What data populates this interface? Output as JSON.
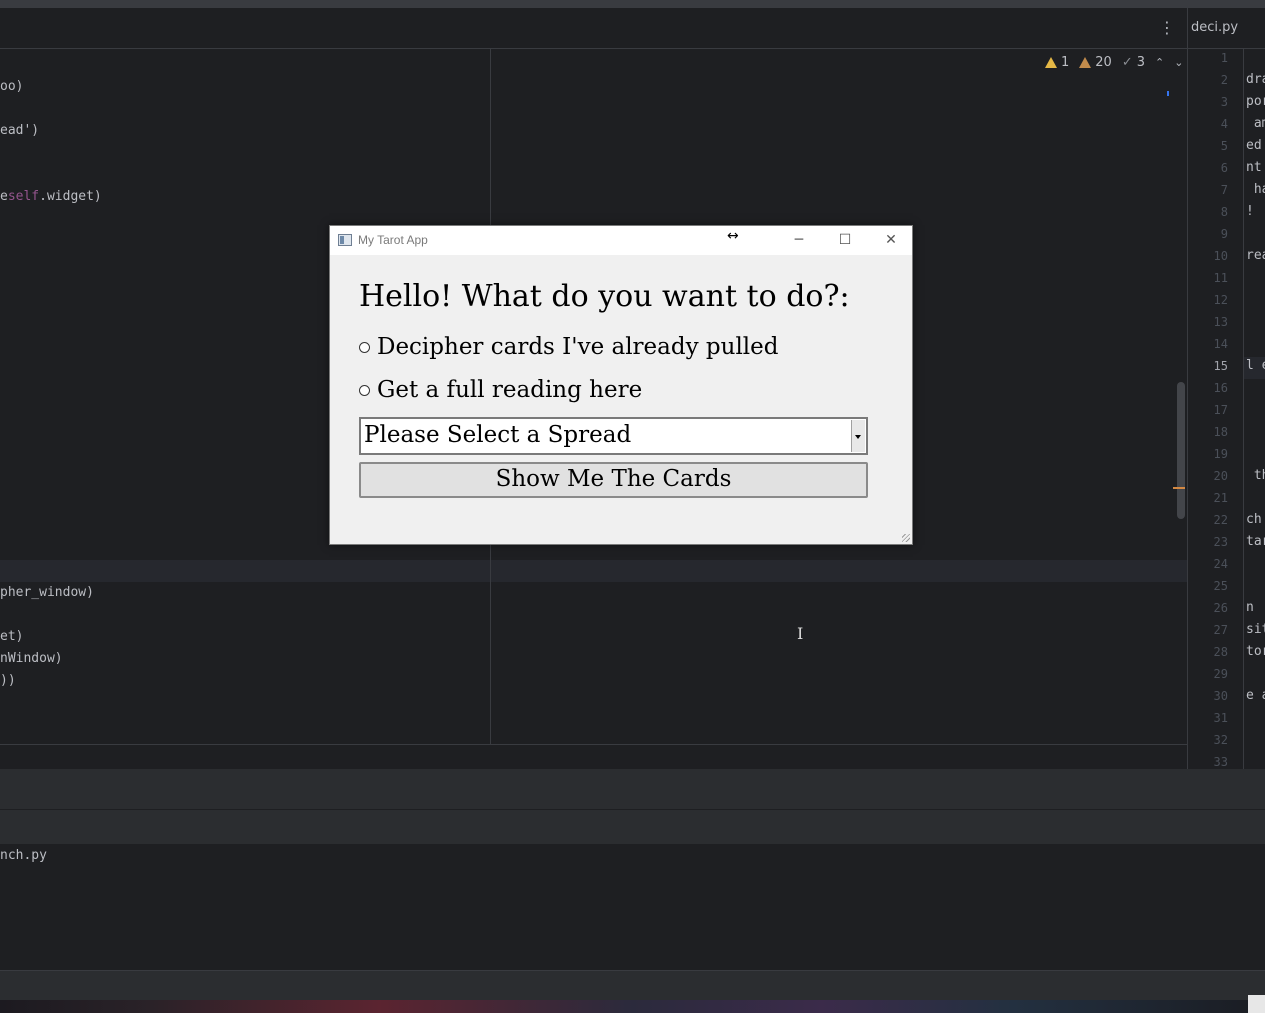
{
  "ide": {
    "right_tab_label": "deci.py",
    "menu_icon": "kebab-menu-icon",
    "inspections": {
      "warnings": "1",
      "weak_warnings": "20",
      "typos": "3"
    },
    "code_left_top": [
      {
        "text": "oo)"
      },
      {
        "text": "ead')"
      },
      {
        "prefix": "e",
        "kw": "self",
        "suffix": ".widget)"
      }
    ],
    "code_left_bottom": [
      "pher_window)",
      "et)",
      "nWindow)",
      "))"
    ],
    "line_numbers": [
      "1",
      "2",
      "3",
      "4",
      "5",
      "6",
      "7",
      "8",
      "9",
      "10",
      "11",
      "12",
      "13",
      "14",
      "15",
      "16",
      "17",
      "18",
      "19",
      "20",
      "21",
      "22",
      "23",
      "24",
      "25",
      "26",
      "27",
      "28",
      "29",
      "30",
      "31",
      "32",
      "33"
    ],
    "current_line": "15",
    "code_right": {
      "2": "dra",
      "3": "por",
      "4": " am",
      "5": "ed ",
      "6": "nt ",
      "7": " ha",
      "8": "!",
      "10": "rea",
      "15": "l e",
      "20": " th",
      "22": "ch ",
      "23": "tar",
      "26": "n",
      "27": "sit",
      "28": "tor",
      "30": "e a"
    },
    "run_output": "nch.py"
  },
  "app": {
    "title": "My Tarot App",
    "heading": "Hello! What do you want to do?:",
    "options": [
      "Decipher cards I've already pulled",
      "Get a full reading here"
    ],
    "spread_select": {
      "value": "Please Select a Spread"
    },
    "show_button": "Show Me The Cards"
  }
}
